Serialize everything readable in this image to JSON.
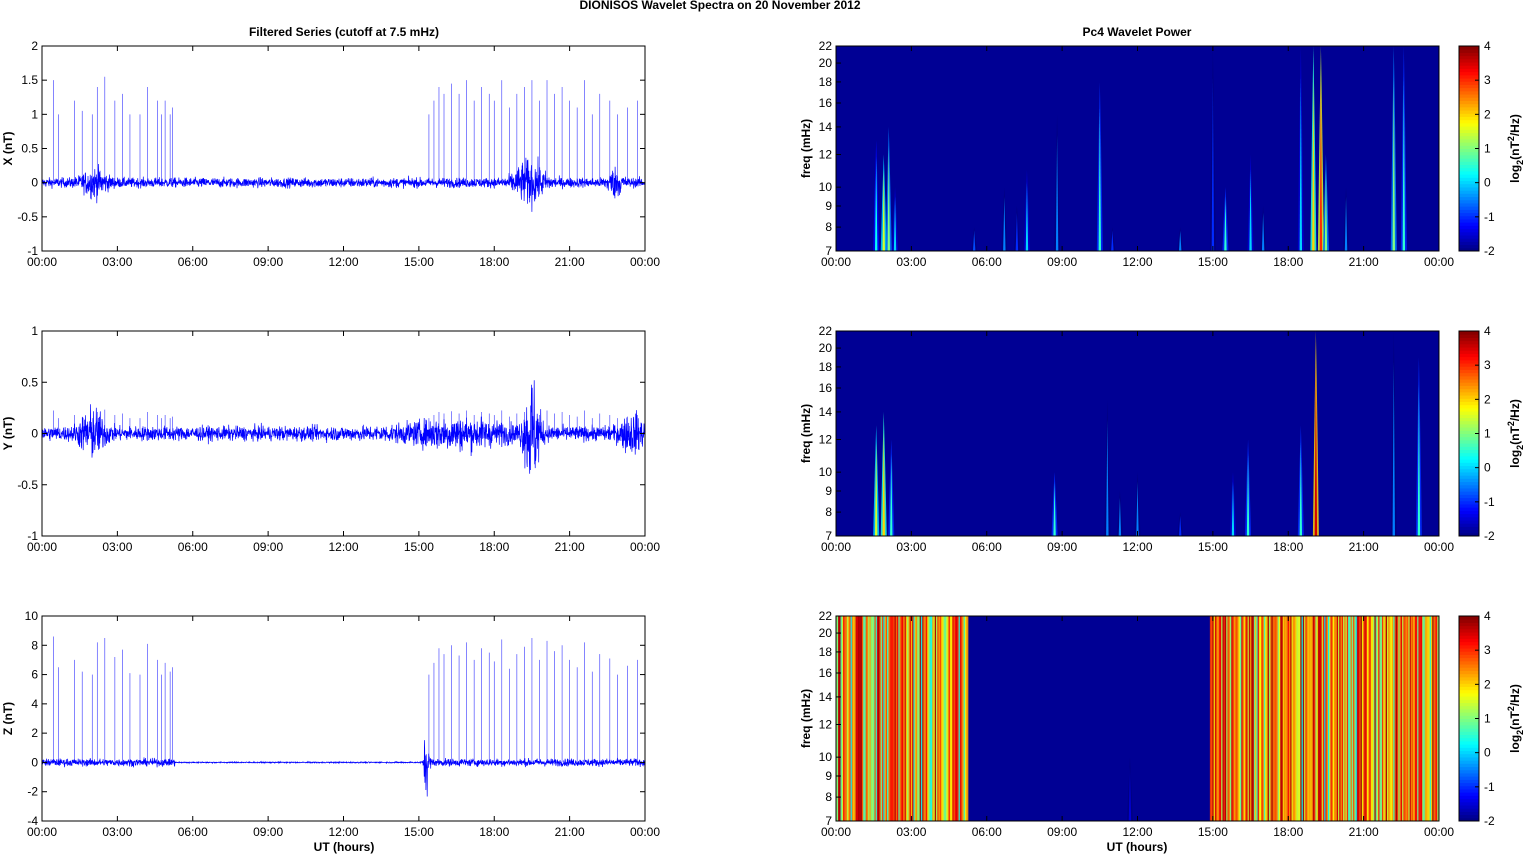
{
  "chart_data": {
    "type": "line+heatmap",
    "title": "DIONISOS Wavelet Spectra on 20 November  2012",
    "left_title": "Filtered Series (cutoff at 7.5 mHz)",
    "right_title": "Pc4 Wavelet Power",
    "xlabel": "UT (hours)",
    "xlim": [
      0,
      24
    ],
    "x_ticks": [
      0,
      3,
      6,
      9,
      12,
      15,
      18,
      21,
      24
    ],
    "x_tick_labels": [
      "00:00",
      "03:00",
      "06:00",
      "09:00",
      "12:00",
      "15:00",
      "18:00",
      "21:00",
      "00:00"
    ],
    "freq_label": "freq (mHz)",
    "freq_ticks": [
      7,
      8,
      9,
      10,
      12,
      14,
      16,
      18,
      20,
      22
    ],
    "freq_lim": [
      7,
      22
    ],
    "colorbar": {
      "label": "log2(nT2/Hz)",
      "label_base": "log",
      "label_sub": "2",
      "label_mid": "(nT",
      "label_sup": "2",
      "label_end": "/Hz)",
      "lim": [
        -2,
        4
      ],
      "ticks": [
        -2,
        -1,
        0,
        1,
        2,
        3,
        4
      ]
    },
    "series_color": "#0000ff",
    "components": [
      {
        "name": "X",
        "ylabel": "X (nT)",
        "ylim": [
          -1,
          2
        ],
        "yticks": [
          -1,
          -0.5,
          0,
          0.5,
          1,
          1.5,
          2
        ],
        "noise": 0.05,
        "bursts": [
          [
            2.1,
            0.5,
            0.12
          ],
          [
            19.4,
            0.6,
            0.2
          ],
          [
            22.8,
            0.3,
            0.12
          ]
        ]
      },
      {
        "name": "Y",
        "ylabel": "Y (nT)",
        "ylim": [
          -1,
          1
        ],
        "yticks": [
          -1,
          -0.5,
          0,
          0.5,
          1
        ],
        "noise": 0.05,
        "bursts": [
          [
            2.0,
            0.5,
            0.14
          ],
          [
            19.5,
            0.3,
            0.35
          ],
          [
            16.5,
            2,
            0.07
          ],
          [
            23.5,
            0.5,
            0.1
          ]
        ]
      },
      {
        "name": "Z",
        "ylabel": "Z (nT)",
        "ylim": [
          -4,
          10
        ],
        "yticks": [
          -4,
          -2,
          0,
          2,
          4,
          6,
          8,
          10
        ],
        "noise": 0.18,
        "quiet": [
          [
            5.3,
            15.2,
            0.03
          ]
        ],
        "bursts": [
          [
            15.3,
            0.1,
            1.5
          ]
        ]
      }
    ],
    "spikes": [
      [
        0.45,
        1.5,
        8.6
      ],
      [
        0.65,
        1.0,
        6.5
      ],
      [
        1.3,
        1.2,
        7.0
      ],
      [
        1.6,
        1.05,
        6.2
      ],
      [
        2.0,
        1.0,
        6.0
      ],
      [
        2.2,
        1.4,
        8.2
      ],
      [
        2.5,
        1.55,
        8.5
      ],
      [
        2.9,
        1.2,
        7.2
      ],
      [
        3.2,
        1.3,
        7.7
      ],
      [
        3.5,
        1.0,
        6.1
      ],
      [
        3.9,
        1.0,
        6.0
      ],
      [
        4.2,
        1.4,
        8.1
      ],
      [
        4.6,
        1.2,
        7.0
      ],
      [
        4.75,
        1.0,
        6.0
      ],
      [
        4.9,
        1.2,
        6.8
      ],
      [
        5.1,
        1.0,
        6.2
      ],
      [
        5.2,
        1.1,
        6.5
      ],
      [
        15.4,
        1.0,
        6.0
      ],
      [
        15.6,
        1.2,
        6.8
      ],
      [
        15.8,
        1.4,
        7.8
      ],
      [
        16.0,
        1.3,
        7.4
      ],
      [
        16.3,
        1.45,
        8.0
      ],
      [
        16.6,
        1.3,
        7.3
      ],
      [
        16.9,
        1.5,
        8.2
      ],
      [
        17.2,
        1.2,
        7.0
      ],
      [
        17.5,
        1.4,
        7.8
      ],
      [
        17.8,
        1.3,
        7.5
      ],
      [
        18.0,
        1.2,
        6.9
      ],
      [
        18.3,
        1.5,
        8.4
      ],
      [
        18.6,
        1.1,
        6.4
      ],
      [
        18.9,
        1.3,
        7.4
      ],
      [
        19.2,
        1.4,
        7.9
      ],
      [
        19.5,
        1.5,
        8.5
      ],
      [
        19.8,
        1.2,
        7.0
      ],
      [
        20.1,
        1.5,
        8.3
      ],
      [
        20.4,
        1.3,
        7.6
      ],
      [
        20.7,
        1.4,
        8.0
      ],
      [
        21.0,
        1.2,
        7.0
      ],
      [
        21.3,
        1.1,
        6.5
      ],
      [
        21.6,
        1.5,
        8.2
      ],
      [
        21.9,
        1.0,
        6.2
      ],
      [
        22.2,
        1.3,
        7.4
      ],
      [
        22.6,
        1.2,
        7.1
      ],
      [
        22.9,
        1.0,
        6.0
      ],
      [
        23.3,
        1.1,
        6.6
      ],
      [
        23.7,
        1.2,
        7.0
      ]
    ],
    "wavelet": [
      {
        "name": "X",
        "events": [
          [
            1.6,
            13,
            0.3
          ],
          [
            1.9,
            12,
            1.5
          ],
          [
            2.1,
            14,
            1
          ],
          [
            2.35,
            10,
            0
          ],
          [
            5.5,
            8,
            -0.8
          ],
          [
            6.7,
            10,
            -0.5
          ],
          [
            7.2,
            9,
            -1
          ],
          [
            7.6,
            11,
            0
          ],
          [
            8.8,
            15,
            -0.5
          ],
          [
            10.5,
            18,
            0.5
          ],
          [
            11.0,
            8,
            -1
          ],
          [
            13.7,
            8,
            -0.5
          ],
          [
            15.0,
            22,
            -1
          ],
          [
            15.5,
            10,
            0.5
          ],
          [
            16.5,
            12,
            0
          ],
          [
            17.0,
            9,
            -0.5
          ],
          [
            18.5,
            22,
            0
          ],
          [
            19.0,
            22,
            2
          ],
          [
            19.3,
            22,
            3
          ],
          [
            19.5,
            12,
            1
          ],
          [
            20.3,
            10,
            -0.5
          ],
          [
            22.2,
            22,
            1
          ],
          [
            22.6,
            22,
            0.5
          ]
        ]
      },
      {
        "name": "Y",
        "events": [
          [
            1.6,
            13,
            1.5
          ],
          [
            1.9,
            14,
            2
          ],
          [
            2.2,
            12,
            0.5
          ],
          [
            8.7,
            10,
            0.5
          ],
          [
            10.8,
            15,
            -0.5
          ],
          [
            11.3,
            9,
            -0.5
          ],
          [
            12.0,
            10,
            -0.5
          ],
          [
            13.7,
            8,
            -1
          ],
          [
            15.8,
            10,
            0
          ],
          [
            16.4,
            12,
            0.5
          ],
          [
            18.5,
            13,
            0.5
          ],
          [
            19.1,
            22,
            3.5
          ],
          [
            22.2,
            22,
            -0.5
          ],
          [
            23.2,
            19,
            0.5
          ]
        ]
      },
      {
        "name": "Z",
        "active_intervals": [
          [
            0.0,
            5.2
          ],
          [
            14.9,
            24.0
          ]
        ],
        "active_power_range": [
          0,
          3.8
        ],
        "events": [
          [
            11.7,
            10,
            -1.5
          ]
        ]
      }
    ]
  }
}
